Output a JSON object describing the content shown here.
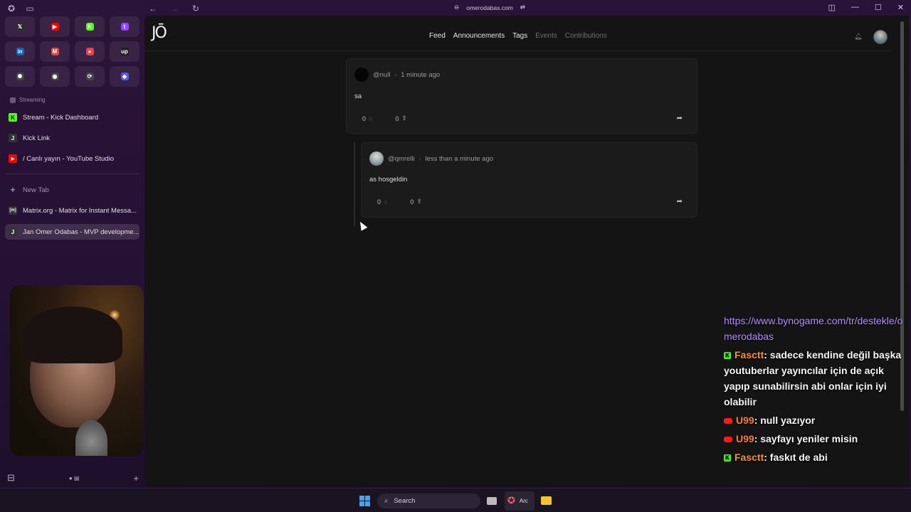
{
  "browser": {
    "url": "omerodabas.com",
    "pinned": [
      {
        "name": "x-icon",
        "glyph": "𝕏",
        "color": "#2d2d2d"
      },
      {
        "name": "youtube-icon",
        "glyph": "▶",
        "color": "#ff0000"
      },
      {
        "name": "kick-icon",
        "glyph": "K",
        "color": "#53fc18"
      },
      {
        "name": "twitch-icon",
        "glyph": "t",
        "color": "#9146ff"
      },
      {
        "name": "linkedin-icon",
        "glyph": "in",
        "color": "#0a66c2"
      },
      {
        "name": "gmail-icon",
        "glyph": "M",
        "color": "#ea4335"
      },
      {
        "name": "music-icon",
        "glyph": "●",
        "color": "#fc3c44"
      },
      {
        "name": "upwork-icon",
        "glyph": "up",
        "color": "#1f1f1f"
      },
      {
        "name": "openai-icon",
        "glyph": "✺",
        "color": "#444"
      },
      {
        "name": "circle-app-icon",
        "glyph": "◉",
        "color": "#444"
      },
      {
        "name": "sync-app-icon",
        "glyph": "⟳",
        "color": "#444"
      },
      {
        "name": "gem-app-icon",
        "glyph": "◆",
        "color": "#5b5bd6"
      }
    ],
    "section_label": "Streaming",
    "tabs": [
      {
        "label": "Stream - Kick Dashboard",
        "fav": "K",
        "fav_color": "#53fc18"
      },
      {
        "label": "Kick Link",
        "fav": "J",
        "fav_color": "#333"
      },
      {
        "label": "/ Canlı yayın - YouTube Studio",
        "fav": "▶",
        "fav_color": "#ff0000"
      }
    ],
    "new_tab_label": "New Tab",
    "tabs_below": [
      {
        "label": "Matrix.org - Matrix for Instant Messa...",
        "fav": "[m]",
        "fav_color": "#333"
      },
      {
        "label": "Jan Omer Odabas - MVP developme...",
        "fav": "J",
        "fav_color": "#333"
      }
    ]
  },
  "site": {
    "logo": "JŌ",
    "nav": [
      {
        "label": "Feed",
        "muted": false
      },
      {
        "label": "Announcements",
        "muted": false
      },
      {
        "label": "Tags",
        "muted": false
      },
      {
        "label": "Events",
        "muted": true
      },
      {
        "label": "Contributions",
        "muted": true
      }
    ]
  },
  "posts": [
    {
      "user": "@null",
      "time": "1 minute ago",
      "text": "sa",
      "comments": "0",
      "upvotes": "0"
    },
    {
      "user": "@qmrelli",
      "time": "less than a minute ago",
      "text": "as hosgeldin",
      "comments": "0",
      "upvotes": "0"
    }
  ],
  "chat": {
    "link": "https://www.bynogame.com/tr/destekle/omerodabas",
    "messages": [
      {
        "platform": "kick",
        "user": "Fasctt",
        "text": ": sadece kendine değil başka youtuberlar yayıncılar için de açık yapıp sunabilirsin abi onlar için iyi olabilir"
      },
      {
        "platform": "youtube",
        "user": "U99",
        "text": ": null yazıyor"
      },
      {
        "platform": "youtube",
        "user": "U99",
        "text": ": sayfayı yeniler misin"
      },
      {
        "platform": "kick",
        "user": "Fasctt",
        "text": ": faskıt de abi"
      }
    ]
  },
  "taskbar": {
    "search_label": "Search",
    "arc_label": "Arc"
  }
}
